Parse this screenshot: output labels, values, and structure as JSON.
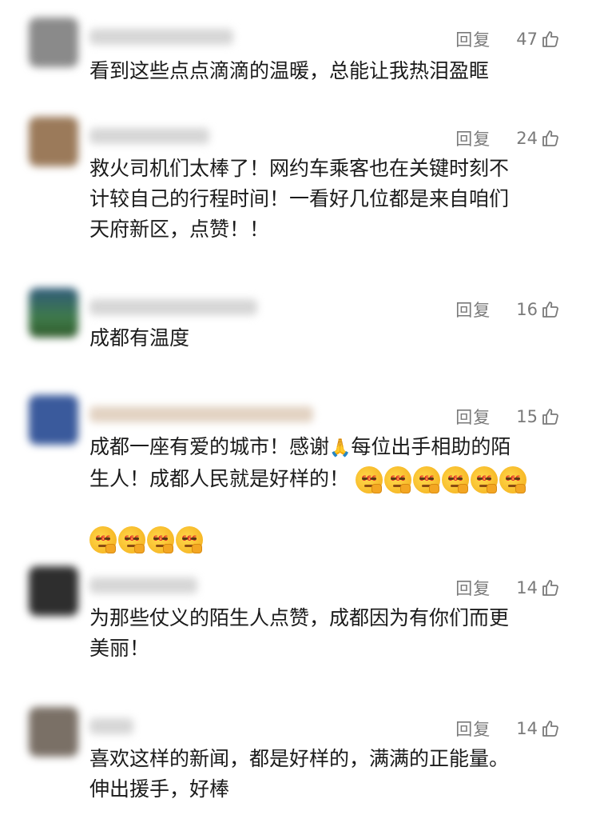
{
  "reply_label": "回复",
  "comments": [
    {
      "likes": "47",
      "text": "看到这些点点滴滴的温暖，总能让我热泪盈眶",
      "avatar_color": "#8a8a8a"
    },
    {
      "likes": "24",
      "text": "救火司机们太棒了！网约车乘客也在关键时刻不\n计较自己的行程时间！一看好几位都是来自咱们\n天府新区，点赞！！",
      "avatar_color": "#9b7a5a"
    },
    {
      "likes": "16",
      "text": "成都有温度",
      "avatar_color": "#3c6a4c"
    },
    {
      "likes": "15",
      "text_a": "成都一座有爱的城市！感谢",
      "text_b": "每位出手相助的陌\n生人！成都人民就是好样的！",
      "pray_emoji": "🙏",
      "emoji_label": "666",
      "emoji_name": "666-emoji",
      "emoji_count": 10,
      "avatar_color": "#3a5a9c"
    },
    {
      "likes": "14",
      "text": "为那些仗义的陌生人点赞，成都因为有你们而更\n美丽！",
      "avatar_color": "#3a3a3a"
    },
    {
      "likes": "14",
      "text": "喜欢这样的新闻，都是好样的，满满的正能量。\n伸出援手，好棒",
      "avatar_color": "#7a7066"
    }
  ],
  "colors": {
    "text": "#1b1b1b",
    "meta": "#7a7a7a",
    "background": "#ffffff"
  }
}
